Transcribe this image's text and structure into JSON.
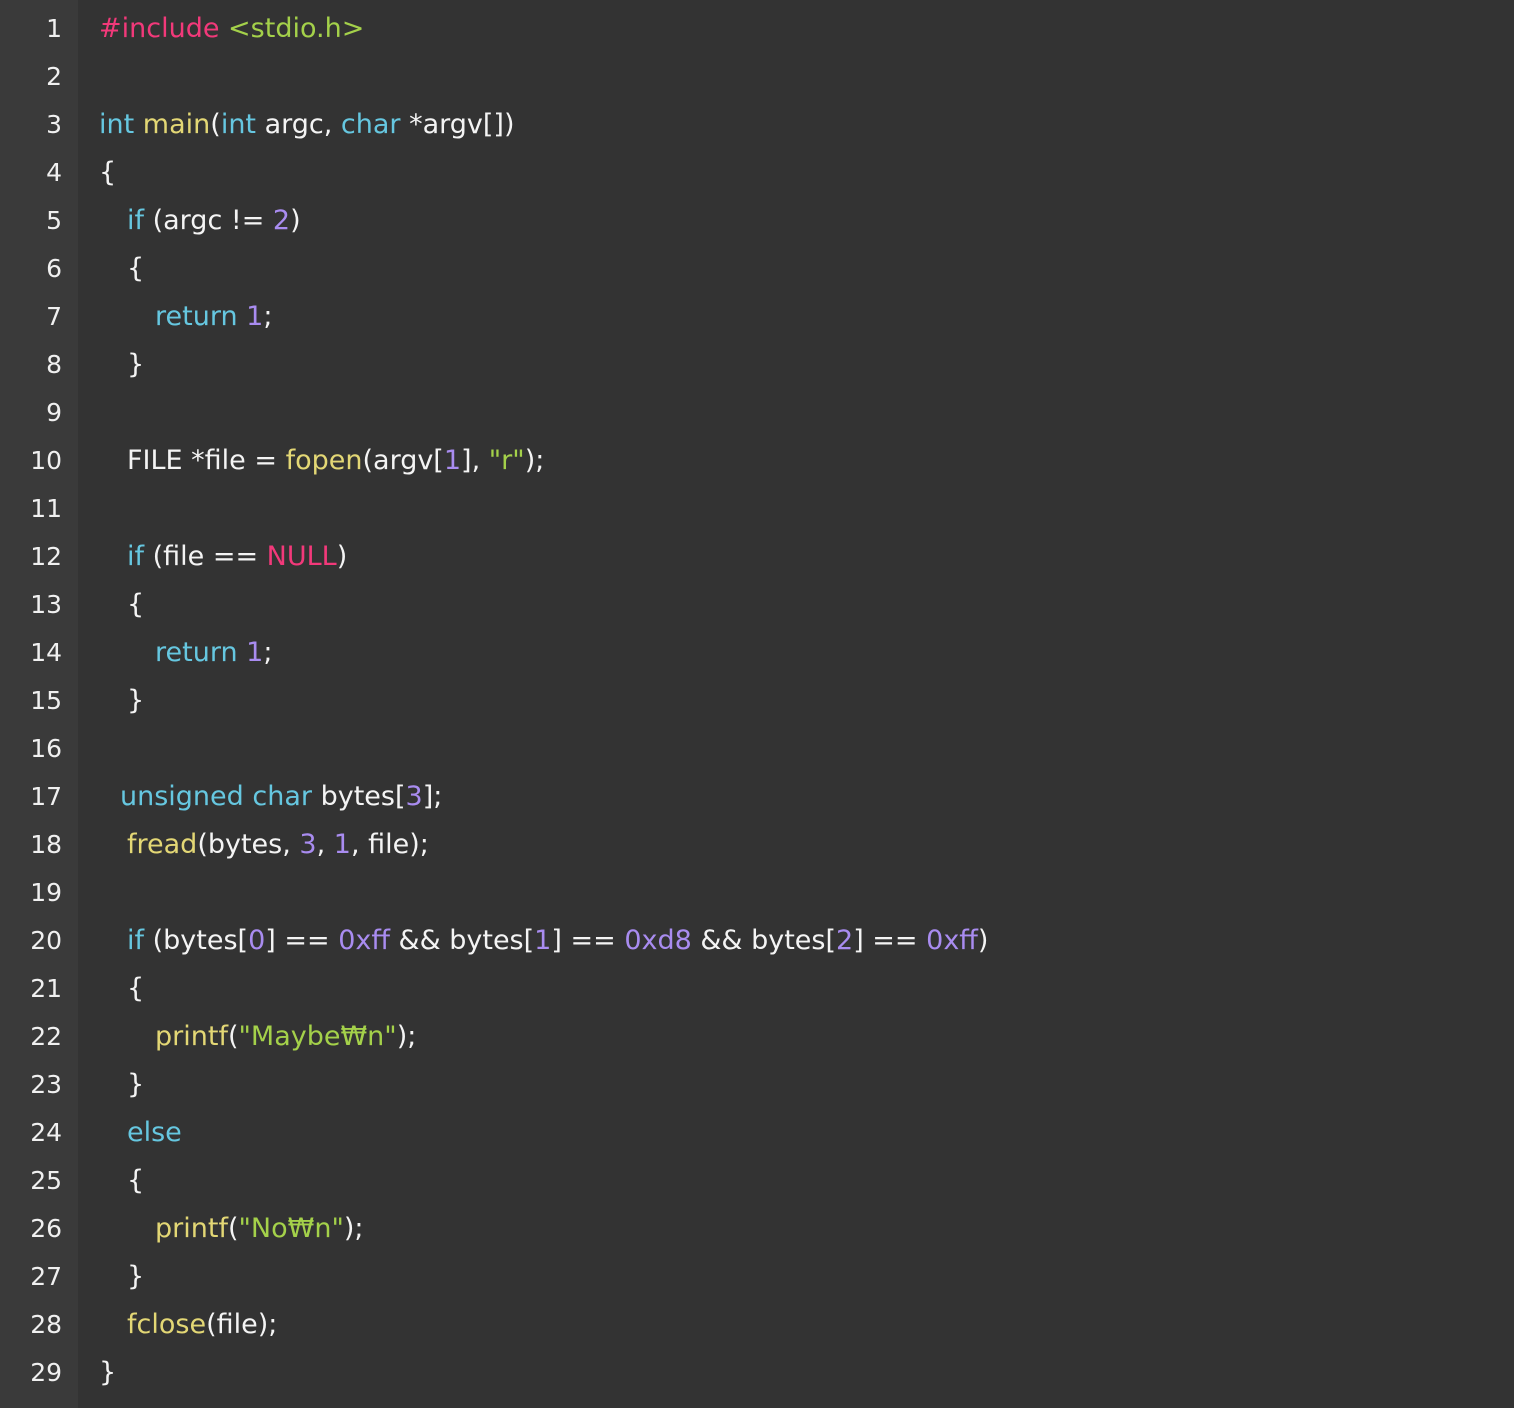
{
  "colors": {
    "background": "#333333",
    "gutter": "#3a3a3a",
    "keyword": "#66c7e0",
    "function": "#e3d775",
    "number": "#a98cf0",
    "string": "#a4d14a",
    "preprocessor": "#f2397a",
    "null": "#f2397a",
    "plain": "#f4f4f4"
  },
  "lines": [
    {
      "n": "1",
      "indent": 0,
      "tokens": [
        [
          "pp",
          "#include"
        ],
        [
          "pl",
          " "
        ],
        [
          "str",
          "<stdio.h>"
        ]
      ]
    },
    {
      "n": "2",
      "indent": 0,
      "tokens": []
    },
    {
      "n": "3",
      "indent": 0,
      "tokens": [
        [
          "kw",
          "int"
        ],
        [
          "pl",
          " "
        ],
        [
          "fn",
          "main"
        ],
        [
          "pl",
          "("
        ],
        [
          "kw",
          "int"
        ],
        [
          "pl",
          " argc, "
        ],
        [
          "kw",
          "char"
        ],
        [
          "pl",
          " *argv[])"
        ]
      ]
    },
    {
      "n": "4",
      "indent": 0,
      "tokens": [
        [
          "pl",
          "{"
        ]
      ]
    },
    {
      "n": "5",
      "indent": 1,
      "tokens": [
        [
          "kw",
          "if"
        ],
        [
          "pl",
          " (argc != "
        ],
        [
          "num",
          "2"
        ],
        [
          "pl",
          ")"
        ]
      ]
    },
    {
      "n": "6",
      "indent": 1,
      "tokens": [
        [
          "pl",
          "{"
        ]
      ]
    },
    {
      "n": "7",
      "indent": 2,
      "tokens": [
        [
          "kw",
          "return"
        ],
        [
          "pl",
          " "
        ],
        [
          "num",
          "1"
        ],
        [
          "pl",
          ";"
        ]
      ]
    },
    {
      "n": "8",
      "indent": 1,
      "tokens": [
        [
          "pl",
          "}"
        ]
      ]
    },
    {
      "n": "9",
      "indent": 0,
      "tokens": []
    },
    {
      "n": "10",
      "indent": 1,
      "tokens": [
        [
          "pl",
          "FILE *file = "
        ],
        [
          "fn",
          "fopen"
        ],
        [
          "pl",
          "(argv["
        ],
        [
          "num",
          "1"
        ],
        [
          "pl",
          "], "
        ],
        [
          "str",
          "\"r\""
        ],
        [
          "pl",
          ");"
        ]
      ]
    },
    {
      "n": "11",
      "indent": 0,
      "tokens": []
    },
    {
      "n": "12",
      "indent": 1,
      "tokens": [
        [
          "kw",
          "if"
        ],
        [
          "pl",
          " (file == "
        ],
        [
          "null",
          "NULL"
        ],
        [
          "pl",
          ")"
        ]
      ]
    },
    {
      "n": "13",
      "indent": 1,
      "tokens": [
        [
          "pl",
          "{"
        ]
      ]
    },
    {
      "n": "14",
      "indent": 2,
      "tokens": [
        [
          "kw",
          "return"
        ],
        [
          "pl",
          " "
        ],
        [
          "num",
          "1"
        ],
        [
          "pl",
          ";"
        ]
      ]
    },
    {
      "n": "15",
      "indent": 1,
      "tokens": [
        [
          "pl",
          "}"
        ]
      ]
    },
    {
      "n": "16",
      "indent": 0,
      "tokens": []
    },
    {
      "n": "17",
      "indent": 1,
      "shift": true,
      "tokens": [
        [
          "kw",
          "unsigned"
        ],
        [
          "pl",
          " "
        ],
        [
          "kw",
          "char"
        ],
        [
          "pl",
          " bytes["
        ],
        [
          "num",
          "3"
        ],
        [
          "pl",
          "];"
        ]
      ]
    },
    {
      "n": "18",
      "indent": 1,
      "tokens": [
        [
          "fn",
          "fread"
        ],
        [
          "pl",
          "(bytes, "
        ],
        [
          "num",
          "3"
        ],
        [
          "pl",
          ", "
        ],
        [
          "num",
          "1"
        ],
        [
          "pl",
          ", file);"
        ]
      ]
    },
    {
      "n": "19",
      "indent": 0,
      "tokens": []
    },
    {
      "n": "20",
      "indent": 1,
      "tokens": [
        [
          "kw",
          "if"
        ],
        [
          "pl",
          " (bytes["
        ],
        [
          "num",
          "0"
        ],
        [
          "pl",
          "] == "
        ],
        [
          "num",
          "0xff"
        ],
        [
          "pl",
          " && bytes["
        ],
        [
          "num",
          "1"
        ],
        [
          "pl",
          "] == "
        ],
        [
          "num",
          "0xd8"
        ],
        [
          "pl",
          " && bytes["
        ],
        [
          "num",
          "2"
        ],
        [
          "pl",
          "] == "
        ],
        [
          "num",
          "0xff"
        ],
        [
          "pl",
          ")"
        ]
      ]
    },
    {
      "n": "21",
      "indent": 1,
      "tokens": [
        [
          "pl",
          "{"
        ]
      ]
    },
    {
      "n": "22",
      "indent": 2,
      "tokens": [
        [
          "fn",
          "printf"
        ],
        [
          "pl",
          "("
        ],
        [
          "str",
          "\"Maybe₩n\""
        ],
        [
          "pl",
          ");"
        ]
      ]
    },
    {
      "n": "23",
      "indent": 1,
      "tokens": [
        [
          "pl",
          "}"
        ]
      ]
    },
    {
      "n": "24",
      "indent": 1,
      "tokens": [
        [
          "kw",
          "else"
        ]
      ]
    },
    {
      "n": "25",
      "indent": 1,
      "tokens": [
        [
          "pl",
          "{"
        ]
      ]
    },
    {
      "n": "26",
      "indent": 2,
      "tokens": [
        [
          "fn",
          "printf"
        ],
        [
          "pl",
          "("
        ],
        [
          "str",
          "\"No₩n\""
        ],
        [
          "pl",
          ");"
        ]
      ]
    },
    {
      "n": "27",
      "indent": 1,
      "tokens": [
        [
          "pl",
          "}"
        ]
      ]
    },
    {
      "n": "28",
      "indent": 1,
      "tokens": [
        [
          "fn",
          "fclose"
        ],
        [
          "pl",
          "(file);"
        ]
      ]
    },
    {
      "n": "29",
      "indent": 0,
      "tokens": [
        [
          "pl",
          "}"
        ]
      ]
    }
  ]
}
